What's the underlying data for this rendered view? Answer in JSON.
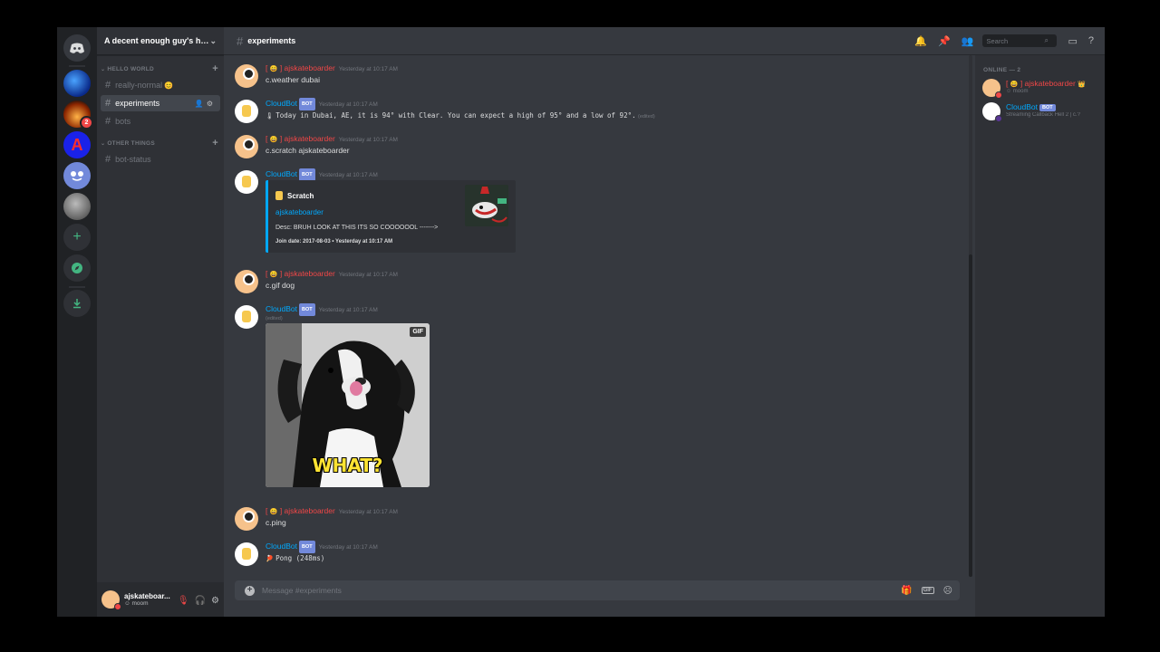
{
  "guild": {
    "name": "A decent enough guy's ha..."
  },
  "categories": [
    {
      "label": "HELLO WORLD",
      "channels": [
        {
          "name": "really-normal",
          "emoji": "😊"
        },
        {
          "name": "experiments",
          "active": true
        },
        {
          "name": "bots"
        }
      ]
    },
    {
      "label": "OTHER THINGS",
      "channels": [
        {
          "name": "bot-status"
        }
      ]
    }
  ],
  "server_badge": "2",
  "user_panel": {
    "name": "ajskateboar...",
    "status": "moom"
  },
  "channel_header": {
    "title": "experiments"
  },
  "search": {
    "placeholder": "Search"
  },
  "messages": [
    {
      "author_prefix": "[ ",
      "author_emoji": "😄",
      "author": "] ajskateboarder",
      "timestamp": "Yesterday at 10:17 AM",
      "text": "c.weather dubai"
    },
    {
      "author": "CloudBot",
      "bot_badge": "BOT",
      "timestamp": "Yesterday at 10:17 AM",
      "icon": "🌡",
      "text": "Today in Dubai, AE, it is 94° with Clear. You can expect a high of 95° and a low of 92°.",
      "edited": "(edited)"
    },
    {
      "author_prefix": "[ ",
      "author_emoji": "😄",
      "author": "] ajskateboarder",
      "timestamp": "Yesterday at 10:17 AM",
      "text": "c.scratch ajskateboarder"
    },
    {
      "author": "CloudBot",
      "bot_badge": "BOT",
      "timestamp": "Yesterday at 10:17 AM",
      "embed": {
        "author": "Scratch",
        "title": "ajskateboarder",
        "description": "Desc: BRUH LOOK AT THIS ITS SO COOOOOOL ------->",
        "footer": "Join date: 2017-08-03 • Yesterday at 10:17 AM"
      }
    },
    {
      "author_prefix": "[ ",
      "author_emoji": "😄",
      "author": "] ajskateboarder",
      "timestamp": "Yesterday at 10:17 AM",
      "text": "c.gif dog"
    },
    {
      "author": "CloudBot",
      "bot_badge": "BOT",
      "timestamp": "Yesterday at 10:17 AM",
      "edited": "(edited)",
      "gif": {
        "tag": "GIF",
        "caption": "WHAT?"
      }
    },
    {
      "author_prefix": "[ ",
      "author_emoji": "😄",
      "author": "] ajskateboarder",
      "timestamp": "Yesterday at 10:17 AM",
      "text": "c.ping"
    },
    {
      "author": "CloudBot",
      "bot_badge": "BOT",
      "timestamp": "Yesterday at 10:17 AM",
      "icon": "🏓",
      "text": "Pong (248ms)"
    }
  ],
  "composer": {
    "placeholder": "Message #experiments"
  },
  "members": {
    "header": "ONLINE — 2",
    "list": [
      {
        "prefix": "[ ",
        "emoji": "😄",
        "name": "] ajskateboarder",
        "crown": "👑",
        "activity": "moom",
        "status_color": "#f04747"
      },
      {
        "name": "CloudBot",
        "bot_badge": "BOT",
        "activity": "Streaming Callback Hell 2 | c.?",
        "status_color": "#593695"
      }
    ]
  },
  "colors": {
    "accent": "#7289da",
    "link": "#00a8fc",
    "danger": "#f04747",
    "online": "#43b581"
  }
}
